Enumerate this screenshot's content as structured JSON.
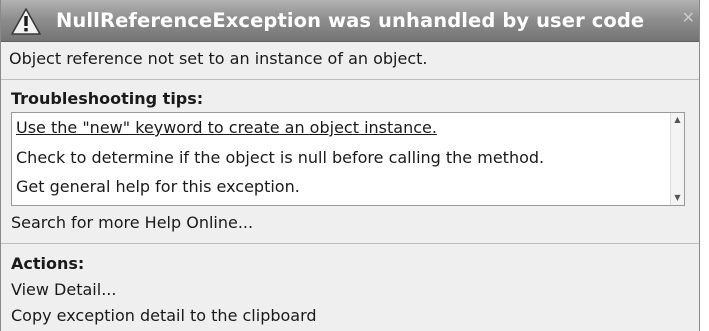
{
  "window": {
    "title": "NullReferenceException was unhandled by user code",
    "title_icon": "warning-icon",
    "close_icon": "close-icon"
  },
  "message": "Object reference not set to an instance of an object.",
  "troubleshooting": {
    "heading": "Troubleshooting tips:",
    "tips": [
      "Use the \"new\" keyword to create an object instance.",
      "Check to determine if the object is null before calling the method.",
      "Get general help for this exception."
    ]
  },
  "search_link": "Search for more Help Online...",
  "actions": {
    "heading": "Actions:",
    "items": [
      "View Detail...",
      "Copy exception detail to the clipboard"
    ]
  },
  "colors": {
    "titlebar": "#8f8f8f",
    "title_text": "#ffffff",
    "background": "#efefef",
    "tips_box": "#ffffff"
  }
}
